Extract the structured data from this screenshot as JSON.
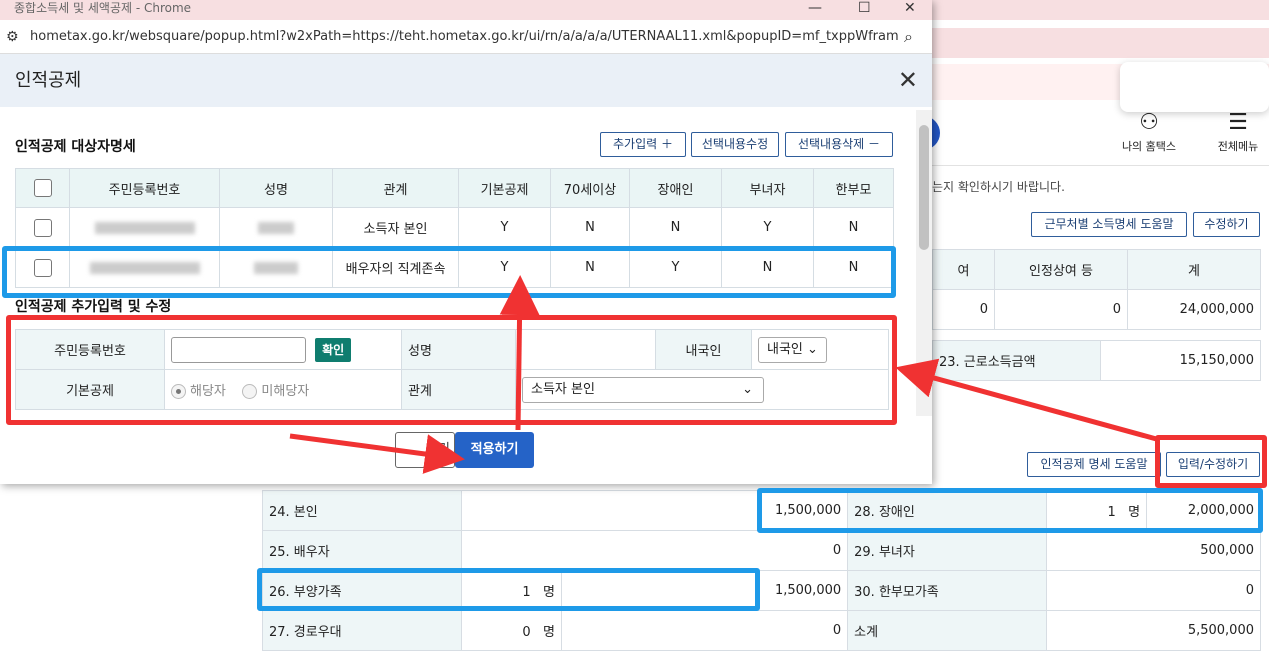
{
  "window": {
    "title": "종합소득세 및 세액공제 - Chrome",
    "url": "hometax.go.kr/websquare/popup.html?w2xPath=https://teht.hometax.go.kr/ui/rn/a/a/a/a/UTERNAAL11.xml&popupID=mf_txppWfram..."
  },
  "modal": {
    "title": "인적공제",
    "close": "✕"
  },
  "section1": {
    "title": "인적공제 대상자명세",
    "btn_add": "추가입력 ＋",
    "btn_edit": "선택내용수정",
    "btn_delete": "선택내용삭제 －",
    "headers": [
      "주민등록번호",
      "성명",
      "관계",
      "기본공제",
      "70세이상",
      "장애인",
      "부녀자",
      "한부모"
    ],
    "rows": [
      {
        "relation": "소득자 본인",
        "basic": "Y",
        "over70": "N",
        "disabled": "N",
        "woman": "Y",
        "single": "N"
      },
      {
        "relation": "배우자의 직계존속",
        "basic": "Y",
        "over70": "N",
        "disabled": "Y",
        "woman": "N",
        "single": "N"
      }
    ]
  },
  "section2": {
    "title": "인적공제 추가입력 및 수정",
    "rrn_label": "주민등록번호",
    "confirm_btn": "확인",
    "name_label": "성명",
    "nationality_label": "내국인",
    "nationality_value": "내국인",
    "basic_label": "기본공제",
    "radio_yes": "해당자",
    "radio_no": "미해당자",
    "relation_label": "관계",
    "relation_value": "소득자 본인"
  },
  "buttons": {
    "cancel": "닫기",
    "apply": "적용하기"
  },
  "header_right": {
    "my_hometax": "나의 홈택스",
    "all_menu": "전체메뉴"
  },
  "notice": "는지 확인하시기 바랍니다.",
  "top_buttons": {
    "help": "근무처별 소득명세 도움말",
    "edit": "수정하기"
  },
  "income_table": {
    "h1": "여",
    "h2": "인정상여 등",
    "h3": "계",
    "v1": "0",
    "v2": "0",
    "v3": "24,000,000",
    "label23": "23. 근로소득금액",
    "value23": "15,150,000"
  },
  "mid_buttons": {
    "help": "인적공제 명세 도움말",
    "input": "입력/수정하기"
  },
  "deduction": {
    "r24": {
      "label": "24. 본인",
      "value": "1,500,000"
    },
    "r25": {
      "label": "25. 배우자",
      "value": "0"
    },
    "r26": {
      "label": "26. 부양가족",
      "count": "1",
      "unit": "명",
      "value": "1,500,000"
    },
    "r27": {
      "label": "27. 경로우대",
      "count": "0",
      "unit": "명",
      "value": "0"
    },
    "r28": {
      "label": "28. 장애인",
      "count": "1",
      "unit": "명",
      "value": "2,000,000"
    },
    "r29": {
      "label": "29. 부녀자",
      "value": "500,000"
    },
    "r30": {
      "label": "30. 한부모가족",
      "value": "0"
    },
    "total": {
      "label": "소계",
      "value": "5,500,000"
    }
  }
}
